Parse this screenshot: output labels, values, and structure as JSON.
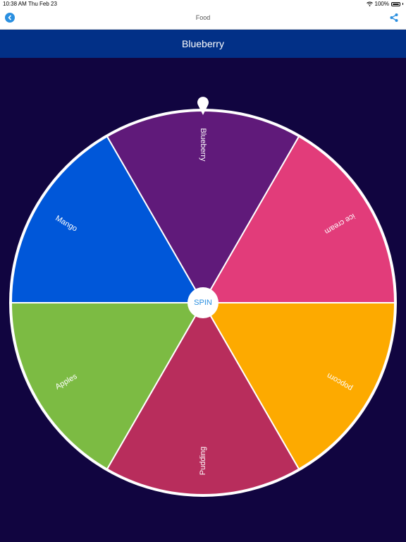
{
  "status": {
    "time": "10:38 AM",
    "date": "Thu Feb 23",
    "battery": "100%"
  },
  "nav": {
    "title": "Food"
  },
  "result": {
    "text": "Blueberry"
  },
  "wheel": {
    "spin_label": "SPIN",
    "segments": [
      {
        "label": "Blueberry",
        "color": "#601a7a"
      },
      {
        "label": "ice cream",
        "color": "#e23c7a"
      },
      {
        "label": "popcorn",
        "color": "#fdaa00"
      },
      {
        "label": "Pudding",
        "color": "#b82d5c"
      },
      {
        "label": "Apples",
        "color": "#7cbb43"
      },
      {
        "label": "Mango",
        "color": "#0057d9"
      }
    ]
  },
  "colors": {
    "background": "#110540",
    "result_bar": "#023087",
    "accent": "#2a8fe0"
  }
}
